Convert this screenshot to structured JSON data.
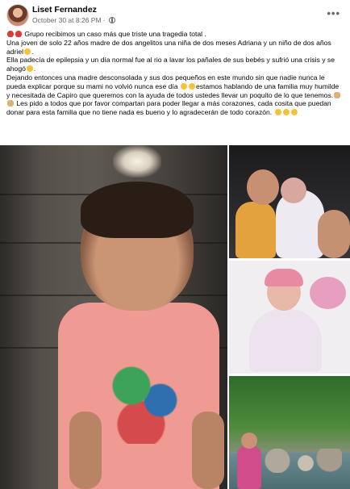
{
  "post": {
    "author": "Liset Fernandez",
    "timestamp": "October 30 at 8:26 PM",
    "separator": "·",
    "more_label": "•••",
    "text": {
      "p1": "Grupo recibimos un caso más que triste una tragedia total .",
      "p2": "Una joven de solo 22 años madre de dos angelitos una niña de dos meses Adriana y un niño de dos años adriel",
      "p3": "Ella padecía de epilepsia y un día normal fue al rio a lavar los pañales de sus bebés y sufrió una crisis y se ahogó",
      "p4a": "Dejando entonces una madre desconsolada y sus dos pequeños en este mundo sin que nadie nunca le pueda explicar porque su mami no volvió nunca ese día",
      "p4b": "estamos hablando de una familia muy humilde y necesitada de Capiro que queremos con la ayuda de todos ustedes llevar un poquito de lo que tenemos.",
      "p4c": "Les pido a todos que por favor compartan para poder llegar a más corazones, cada cosita que puedan donar para esta familia que no tiene nada es bueno y lo agradecerán de todo corazón."
    },
    "icons": {
      "avatar": "avatar-photo",
      "privacy": "globe-icon",
      "more": "more-options-icon"
    },
    "photos": [
      "photo-toddler-pink-shirt",
      "photo-siblings",
      "photo-baby-doll",
      "photo-river"
    ]
  }
}
